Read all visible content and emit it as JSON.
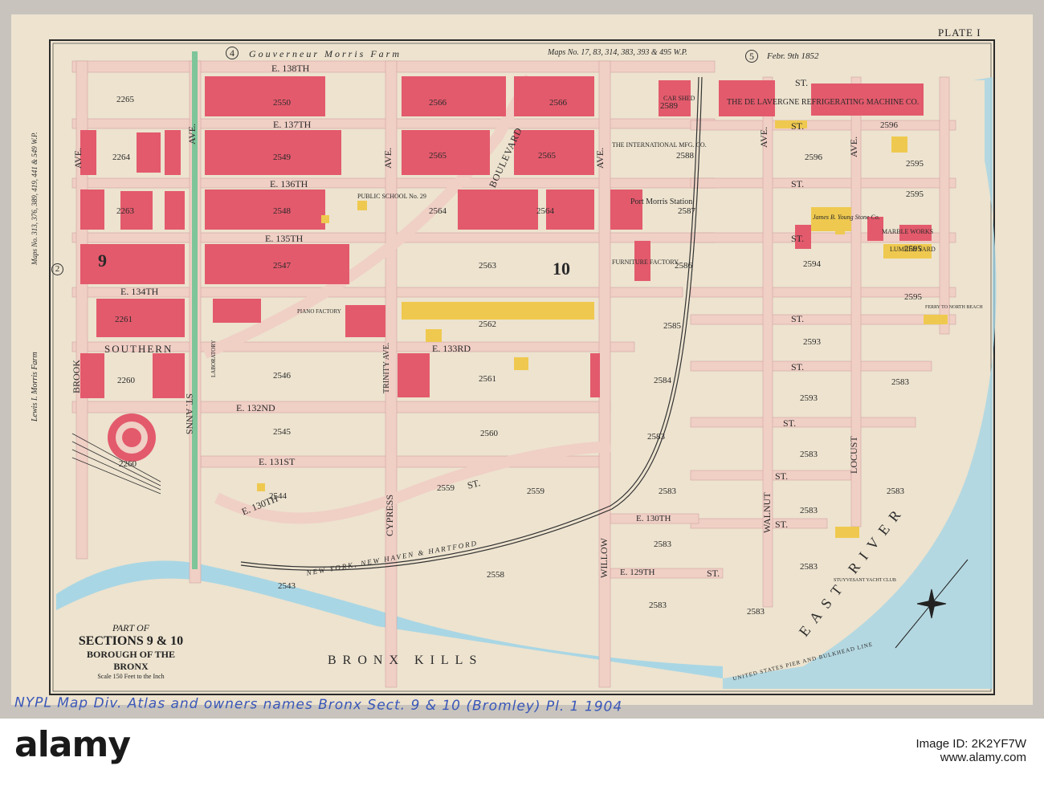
{
  "plate_label": "PLATE I",
  "title": {
    "part": "PART OF",
    "sections": "SECTIONS 9 & 10",
    "borough": "BOROUGH OF THE BRONX",
    "scale": "Scale 150 Feet to the Inch"
  },
  "header": {
    "map_no_4": "4",
    "map_no_5": "5",
    "farm": "Gouverneur Morris Farm",
    "maps_ref": "Maps No. 17, 83, 314, 383, 393 & 495 W.P.",
    "date": "Febr. 9th 1852",
    "left_ref": "Maps No. 313, 376, 389, 419, 441 & 549 W.P.",
    "left_farm": "Lewis I. Morris Farm",
    "map_no_2": "2"
  },
  "streets": {
    "e138": "E. 138TH",
    "e137": "E. 137TH",
    "e136": "E. 136TH",
    "e135": "E. 135TH",
    "e134": "E. 134TH",
    "e133": "E. 133RD",
    "e132": "E. 132ND",
    "e131": "E. 131ST",
    "e130": "E. 130TH",
    "e130b": "E. 130TH",
    "e129": "E. 129TH",
    "st": "ST.",
    "southern": "SOUTHERN",
    "brook": "BROOK",
    "st_anns": "ST. ANNS",
    "ave": "AVE.",
    "boulevard": "BOULEVARD",
    "trinity": "TRINITY AVE.",
    "cypress": "CYPRESS",
    "willow": "WILLOW",
    "walnut": "WALNUT",
    "locust": "LOCUST",
    "rail": "NEW YORK, NEW HAVEN & HARTFORD",
    "bronx_kills": "BRONX  KILLS",
    "east_river": "EAST  RIVER",
    "bulkhead": "UNITED STATES PIER AND BULKHEAD LINE"
  },
  "features": {
    "delavergne": "THE DE LAVERGNE REFRIGERATING MACHINE CO.",
    "car_shed": "CAR SHED",
    "international": "THE INTERNATIONAL MFG. CO.",
    "port_morris": "Port Morris Station",
    "public_school": "PUBLIC SCHOOL No. 29",
    "furniture": "FURNITURE FACTORY",
    "young_stone": "James B. Young Stone Co.",
    "marble": "MARBLE WORKS",
    "lumber": "LUMBER YARD",
    "ferry": "FERRY TO NORTH BEACH",
    "yacht": "STUYVESANT YACHT CLUB",
    "piano": "PIANO FACTORY",
    "laboratory": "LABORATORY"
  },
  "blocks": [
    "2265",
    "2264",
    "2263",
    "2261",
    "2260",
    "2260",
    "2550",
    "2549",
    "2548",
    "2547",
    "2546",
    "2545",
    "2544",
    "2543",
    "2566",
    "2565",
    "2564",
    "2563",
    "2562",
    "2561",
    "2560",
    "2559",
    "2559",
    "2558",
    "2566",
    "2565",
    "2564",
    "2589",
    "2588",
    "2587",
    "2586",
    "2585",
    "2584",
    "2583",
    "2583",
    "2583",
    "2583",
    "2583",
    "2596",
    "2596",
    "2595",
    "2595",
    "2594",
    "2593",
    "2593",
    "2583",
    "2583",
    "2583",
    "2595",
    "2595",
    "2583",
    "2583"
  ],
  "section_numbers": {
    "s9": "9",
    "s10": "10"
  },
  "handwritten_note": "NYPL  Map Div.  Atlas and owners names  Bronx  Sect. 9 & 10  (Bromley)  Pl. 1  1904",
  "watermark": {
    "logo": "alamy",
    "image_id": "Image ID: 2K2YF7W",
    "site": "www.alamy.com"
  },
  "colors": {
    "paper": "#ede3cf",
    "brick": "#e35a6c",
    "frame": "#efc94f",
    "water": "#a9d6e4",
    "street": "#f0cfc5",
    "rail_green": "#9bd3ad"
  }
}
